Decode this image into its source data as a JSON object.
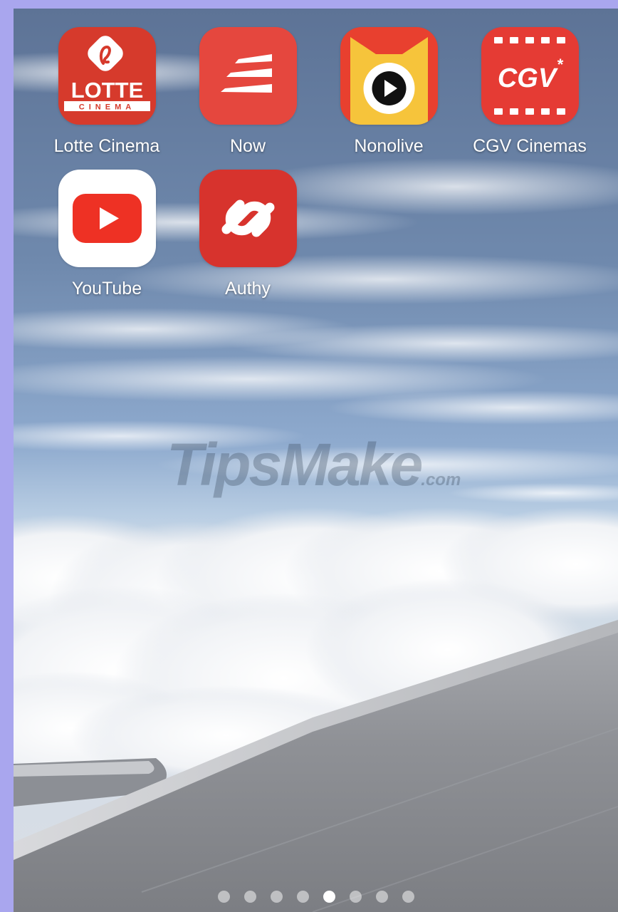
{
  "home_screen": {
    "apps": [
      {
        "label": "Lotte Cinema",
        "icon": "lotte-cinema-icon"
      },
      {
        "label": "Now",
        "icon": "now-icon"
      },
      {
        "label": "Nonolive",
        "icon": "nonolive-icon"
      },
      {
        "label": "CGV Cinemas",
        "icon": "cgv-cinemas-icon"
      },
      {
        "label": "YouTube",
        "icon": "youtube-icon"
      },
      {
        "label": "Authy",
        "icon": "authy-icon"
      }
    ],
    "icon_text": {
      "lotte_wordmark": "LOTTE",
      "lotte_sub": "CINEMA",
      "cgv_wordmark": "CGV",
      "cgv_star": "*"
    },
    "page_indicator": {
      "total_pages": 8,
      "current_page": 5
    }
  },
  "watermark": {
    "brand": "TipsMake",
    "suffix": ".com"
  },
  "colors": {
    "frame_border": "#a9a6ee",
    "lotte_red": "#d63a2c",
    "now_red": "#e5473e",
    "nonolive_yellow": "#f6c43b",
    "cgv_red": "#e53b34",
    "youtube_red": "#ee3124",
    "authy_red": "#d7332d",
    "label_text": "#ffffff"
  }
}
